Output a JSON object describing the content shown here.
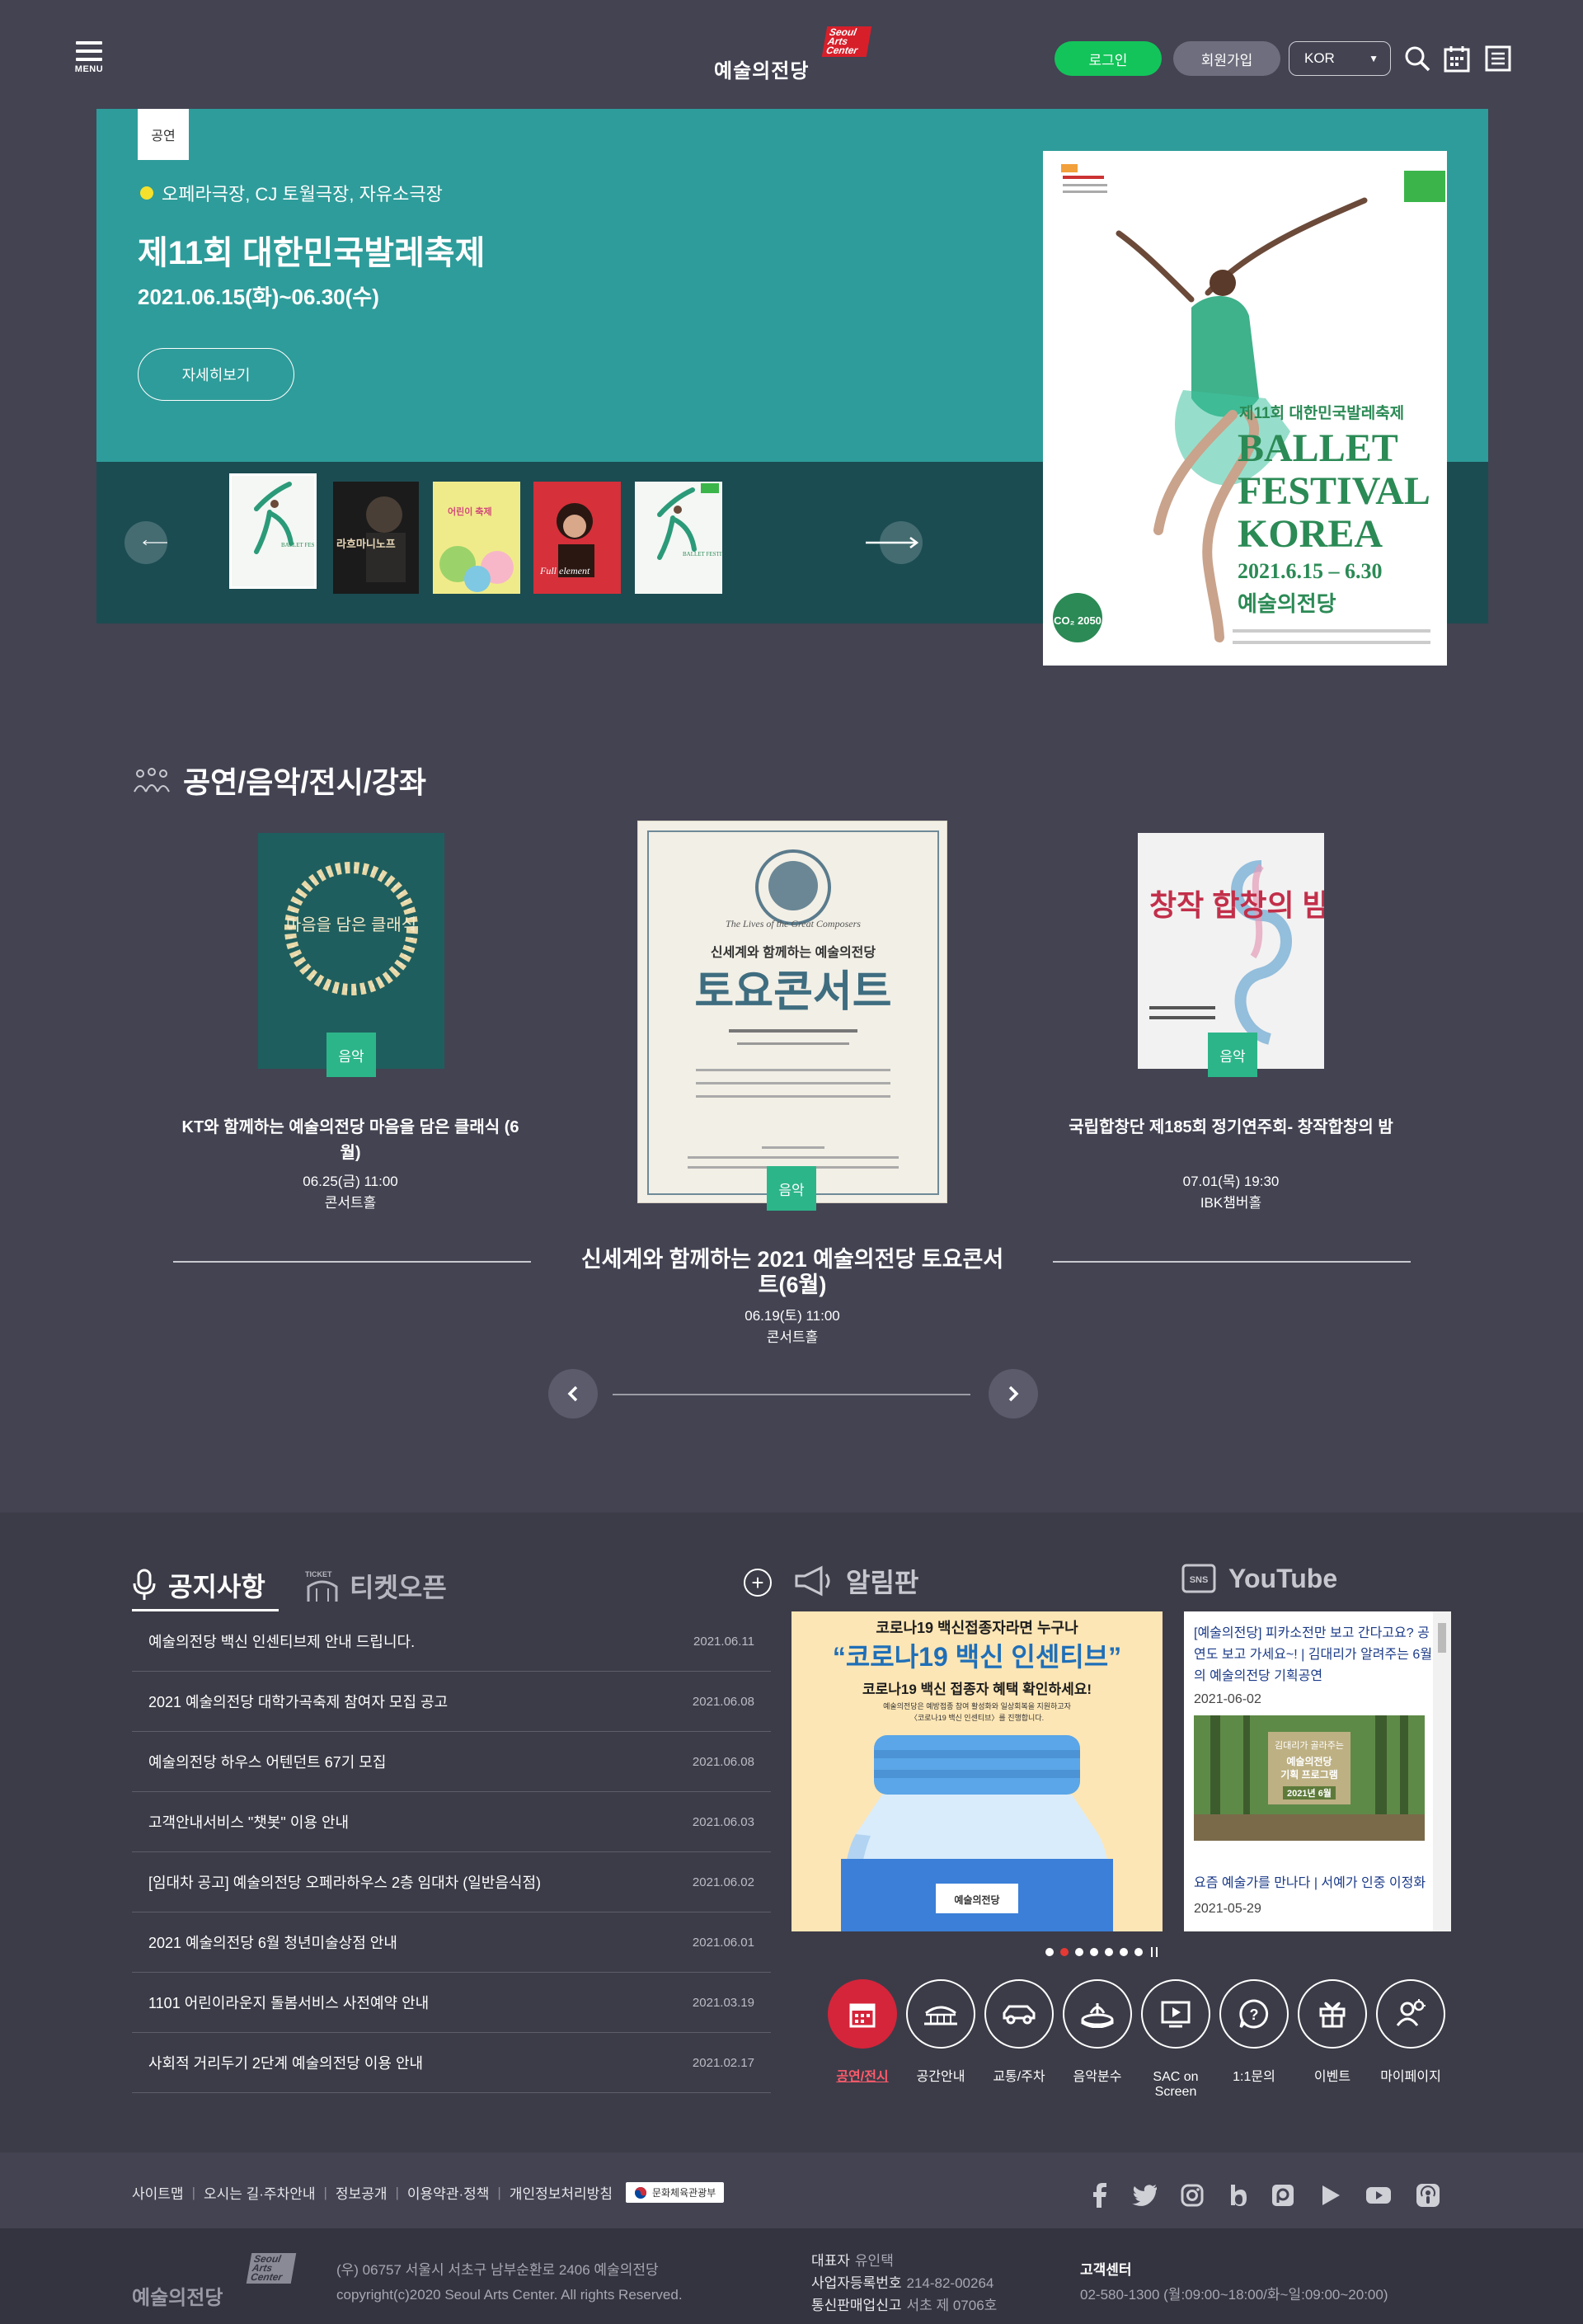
{
  "header": {
    "menu_label": "MENU",
    "logo_text": "예술의전당",
    "logo_badge": "Seoul Arts Center",
    "login": "로그인",
    "join": "회원가입",
    "language": "KOR"
  },
  "hero": {
    "tag": "공연",
    "venue": "오페라극장, CJ 토월극장, 자유소극장",
    "title": "제11회 대한민국발레축제",
    "date": "2021.06.15(화)~06.30(수)",
    "more": "자세히보기",
    "poster": {
      "ko_title": "제11회 대한민국발레축제",
      "line1": "BALLET",
      "line2": "FESTIVAL",
      "line3": "KOREA",
      "dates": "2021.6.15 – 6.30",
      "org": "예술의전당",
      "co2": "CO₂ 2050"
    },
    "thumbs": [
      "BALLET FESTIVAL KOREA",
      "라흐마니노프",
      "어린이 축제",
      "Full element",
      "BALLET FESTIVAL KOREA"
    ]
  },
  "events": {
    "section_title": "공연/음악/전시/강좌",
    "items": [
      {
        "title": "KT와 함께하는 예술의전당 마음을 담은 클래식 (6월)",
        "date": "06.25(금) 11:00",
        "venue": "콘서트홀",
        "category": "음악",
        "poster_text": "마음을 담은 클래식"
      },
      {
        "title": "신세계와 함께하는 2021 예술의전당 토요콘서트(6월)",
        "date": "06.19(토) 11:00",
        "venue": "콘서트홀",
        "category": "음악",
        "poster_text": "토요콘서트",
        "poster_sub": "신세계와 함께하는 예술의전당",
        "poster_italic": "The Lives of the Great Composers"
      },
      {
        "title": "국립합창단 제185회 정기연주회- 창작합창의 밤",
        "date": "07.01(목) 19:30",
        "venue": "IBK챔버홀",
        "category": "음악",
        "poster_text": "창작 합창의 밤"
      }
    ]
  },
  "notices": {
    "tab_active": "공지사항",
    "tab_other": "티켓오픈",
    "items": [
      {
        "title": "예술의전당 백신 인센티브제 안내 드립니다.",
        "date": "2021.06.11"
      },
      {
        "title": "2021 예술의전당 대학가곡축제 참여자 모집 공고",
        "date": "2021.06.08"
      },
      {
        "title": "예술의전당 하우스 어텐던트 67기 모집",
        "date": "2021.06.08"
      },
      {
        "title": "고객안내서비스 \"챗봇\" 이용 안내",
        "date": "2021.06.03"
      },
      {
        "title": "[임대차 공고] 예술의전당 오페라하우스 2층 임대차 (일반음식점)",
        "date": "2021.06.02"
      },
      {
        "title": "2021 예술의전당 6월 청년미술상점 안내",
        "date": "2021.06.01"
      },
      {
        "title": "1101 어린이라운지 돌봄서비스 사전예약 안내",
        "date": "2021.03.19"
      },
      {
        "title": "사회적 거리두기 2단계 예술의전당 이용 안내",
        "date": "2021.02.17"
      }
    ]
  },
  "board": {
    "title": "알림판",
    "line1": "코로나19 백신접종자라면 누구나",
    "line2": "“코로나19 백신 인센티브”",
    "line3": "코로나19 백신 접종자 혜택 확인하세요!",
    "line4": "예술의전당은 예방접종 참여 활성화와 일상회복을 지원하고자",
    "line5": "〈코로나19 백신 인센티브〉를 진행합니다.",
    "org": "예술의전당"
  },
  "youtube": {
    "title": "YouTube",
    "item1_title": "[예술의전당] 피카소전만 보고 간다고요? 공연도 보고 가세요~! | 김대리가 알려주는 6월의 예술의전당 기획공연",
    "item1_date": "2021-06-02",
    "thumb_line1": "김대리가 골라주는",
    "thumb_line2": "예술의전당",
    "thumb_line3": "기획 프로그램",
    "thumb_line4": "2021년 6월",
    "item2_title": "요즘 예술가를 만나다 | 서예가 인중 이정화",
    "item2_date": "2021-05-29"
  },
  "quick_menu": [
    {
      "label": "공연/전시",
      "icon": "calendar-icon"
    },
    {
      "label": "공간안내",
      "icon": "building-icon"
    },
    {
      "label": "교통/주차",
      "icon": "car-icon"
    },
    {
      "label": "음악분수",
      "icon": "fountain-icon"
    },
    {
      "label": "SAC on Screen",
      "icon": "screen-icon"
    },
    {
      "label": "1:1문의",
      "icon": "question-icon"
    },
    {
      "label": "이벤트",
      "icon": "gift-icon"
    },
    {
      "label": "마이페이지",
      "icon": "mypage-icon"
    }
  ],
  "footer": {
    "links": [
      "사이트맵",
      "오시는 길·주차안내",
      "정보공개",
      "이용약관·정책",
      "개인정보처리방침"
    ],
    "gov_label": "문화체육관광부",
    "logo_text": "예술의전당",
    "logo_badge": "Seoul Arts Center",
    "address": "(우) 06757 서울시 서초구 남부순환로 2406 예술의전당",
    "copyright": "copyright(c)2020 Seoul Arts Center. All rights Reserved.",
    "ceo_label": "대표자",
    "ceo": "유인택",
    "biz_label": "사업자등록번호",
    "biz": "214-82-00264",
    "mail_label": "통신판매업신고",
    "mail": "서초 제 0706호",
    "cs_label": "고객센터",
    "cs": "02-580-1300 (월:09:00~18:00/화~일:09:00~20:00)"
  },
  "colors": {
    "background": "#434352",
    "hero_teal": "#2e9c9a",
    "hero_dark": "#1b4c52",
    "login_green": "#13c45a",
    "category_green": "#2db58a",
    "accent_red": "#d5253a"
  }
}
